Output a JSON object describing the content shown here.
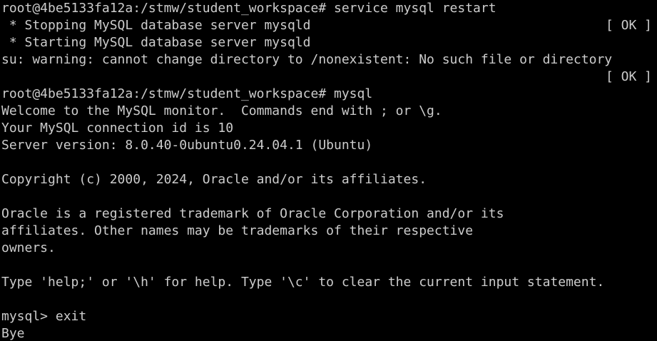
{
  "colors": {
    "background": "#000000",
    "foreground": "#cccccc"
  },
  "terminal": {
    "prompt1": "root@4be5133fa12a:/stmw/student_workspace# service mysql restart",
    "stopping": " * Stopping MySQL database server mysqld",
    "stopping_status": "[ OK ]",
    "starting": " * Starting MySQL database server mysqld",
    "warning": "su: warning: cannot change directory to /nonexistent: No such file or directory",
    "starting_status": "[ OK ]",
    "prompt2": "root@4be5133fa12a:/stmw/student_workspace# mysql",
    "welcome": "Welcome to the MySQL monitor.  Commands end with ; or \\g.",
    "connection_id": "Your MySQL connection id is 10",
    "server_version": "Server version: 8.0.40-0ubuntu0.24.04.1 (Ubuntu)",
    "copyright": "Copyright (c) 2000, 2024, Oracle and/or its affiliates.",
    "trademark1": "Oracle is a registered trademark of Oracle Corporation and/or its",
    "trademark2": "affiliates. Other names may be trademarks of their respective",
    "trademark3": "owners.",
    "help": "Type 'help;' or '\\h' for help. Type '\\c' to clear the current input statement.",
    "mysql_prompt": "mysql> exit",
    "bye": "Bye"
  }
}
